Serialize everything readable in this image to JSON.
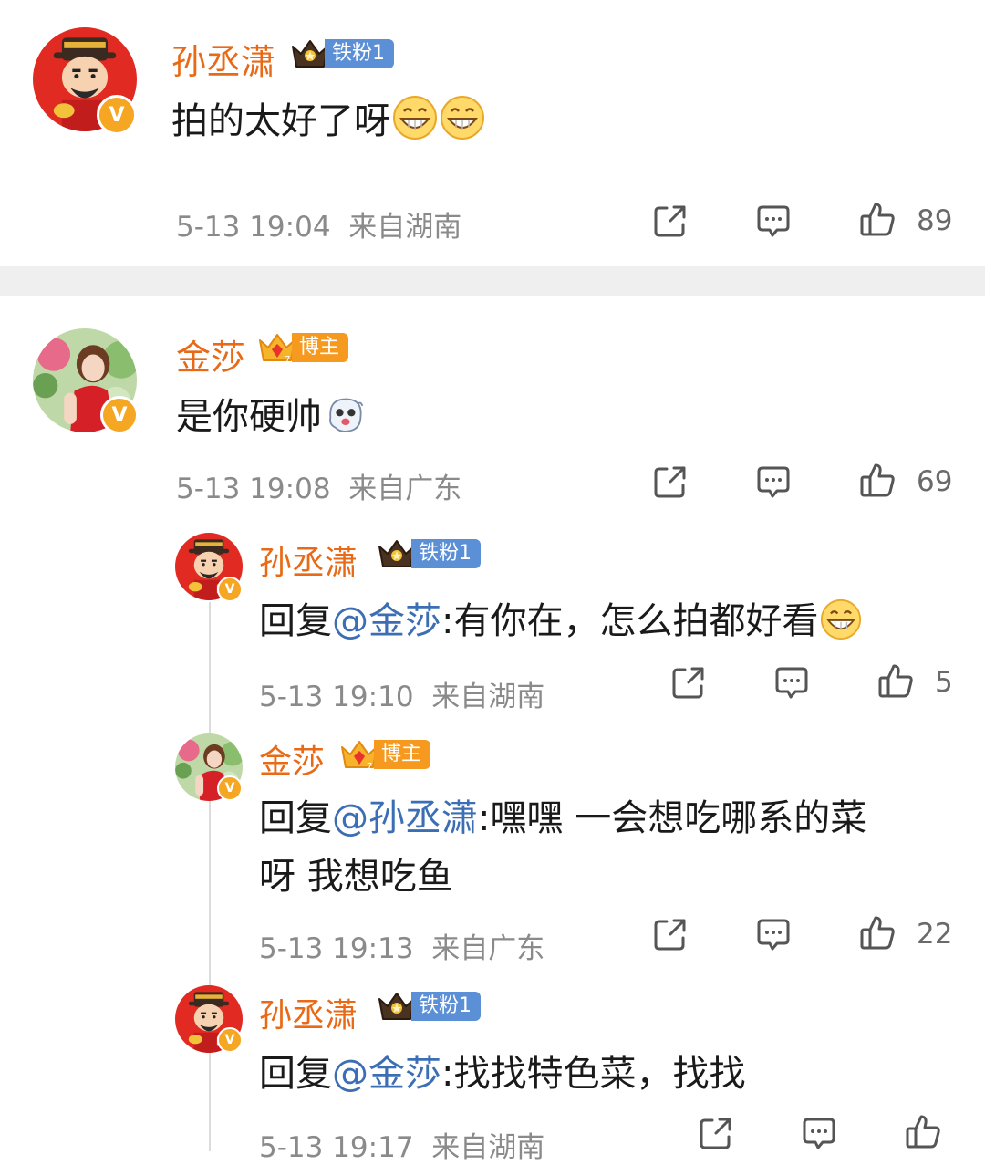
{
  "comments": [
    {
      "user": "孙丞潇",
      "badge": "铁粉1",
      "text": "拍的太好了呀",
      "time": "5-13 19:04",
      "location": "来自湖南",
      "likes": "89"
    },
    {
      "user": "金莎",
      "badge": "博主",
      "text": "是你硬帅",
      "time": "5-13 19:08",
      "location": "来自广东",
      "likes": "69",
      "replies": [
        {
          "user": "孙丞潇",
          "badge": "铁粉1",
          "reply_prefix": "回复",
          "mention": "@金莎",
          "text": ":有你在，怎么拍都好看",
          "time": "5-13 19:10",
          "location": "来自湖南",
          "likes": "5"
        },
        {
          "user": "金莎",
          "badge": "博主",
          "reply_prefix": "回复",
          "mention": "@孙丞潇",
          "text_line1": ":嘿嘿 一会想吃哪系的菜",
          "text_line2": "呀 我想吃鱼",
          "time": "5-13 19:13",
          "location": "来自广东",
          "likes": "22"
        },
        {
          "user": "孙丞潇",
          "badge": "铁粉1",
          "reply_prefix": "回复",
          "mention": "@金莎",
          "text": ":找找特色菜，找找",
          "time": "5-13 19:17",
          "location": "来自湖南"
        }
      ]
    }
  ],
  "colors": {
    "username": "#e86a17",
    "mention": "#3c6eb4",
    "fan_badge": "#5b8fd6",
    "host_badge": "#f59a1f",
    "verified": "#f5a623",
    "meta": "#8a8a8a"
  },
  "icons": [
    "share-icon",
    "comment-icon",
    "like-icon",
    "verified-icon",
    "crown-icon",
    "grin-emoji",
    "ghost-emoji"
  ]
}
